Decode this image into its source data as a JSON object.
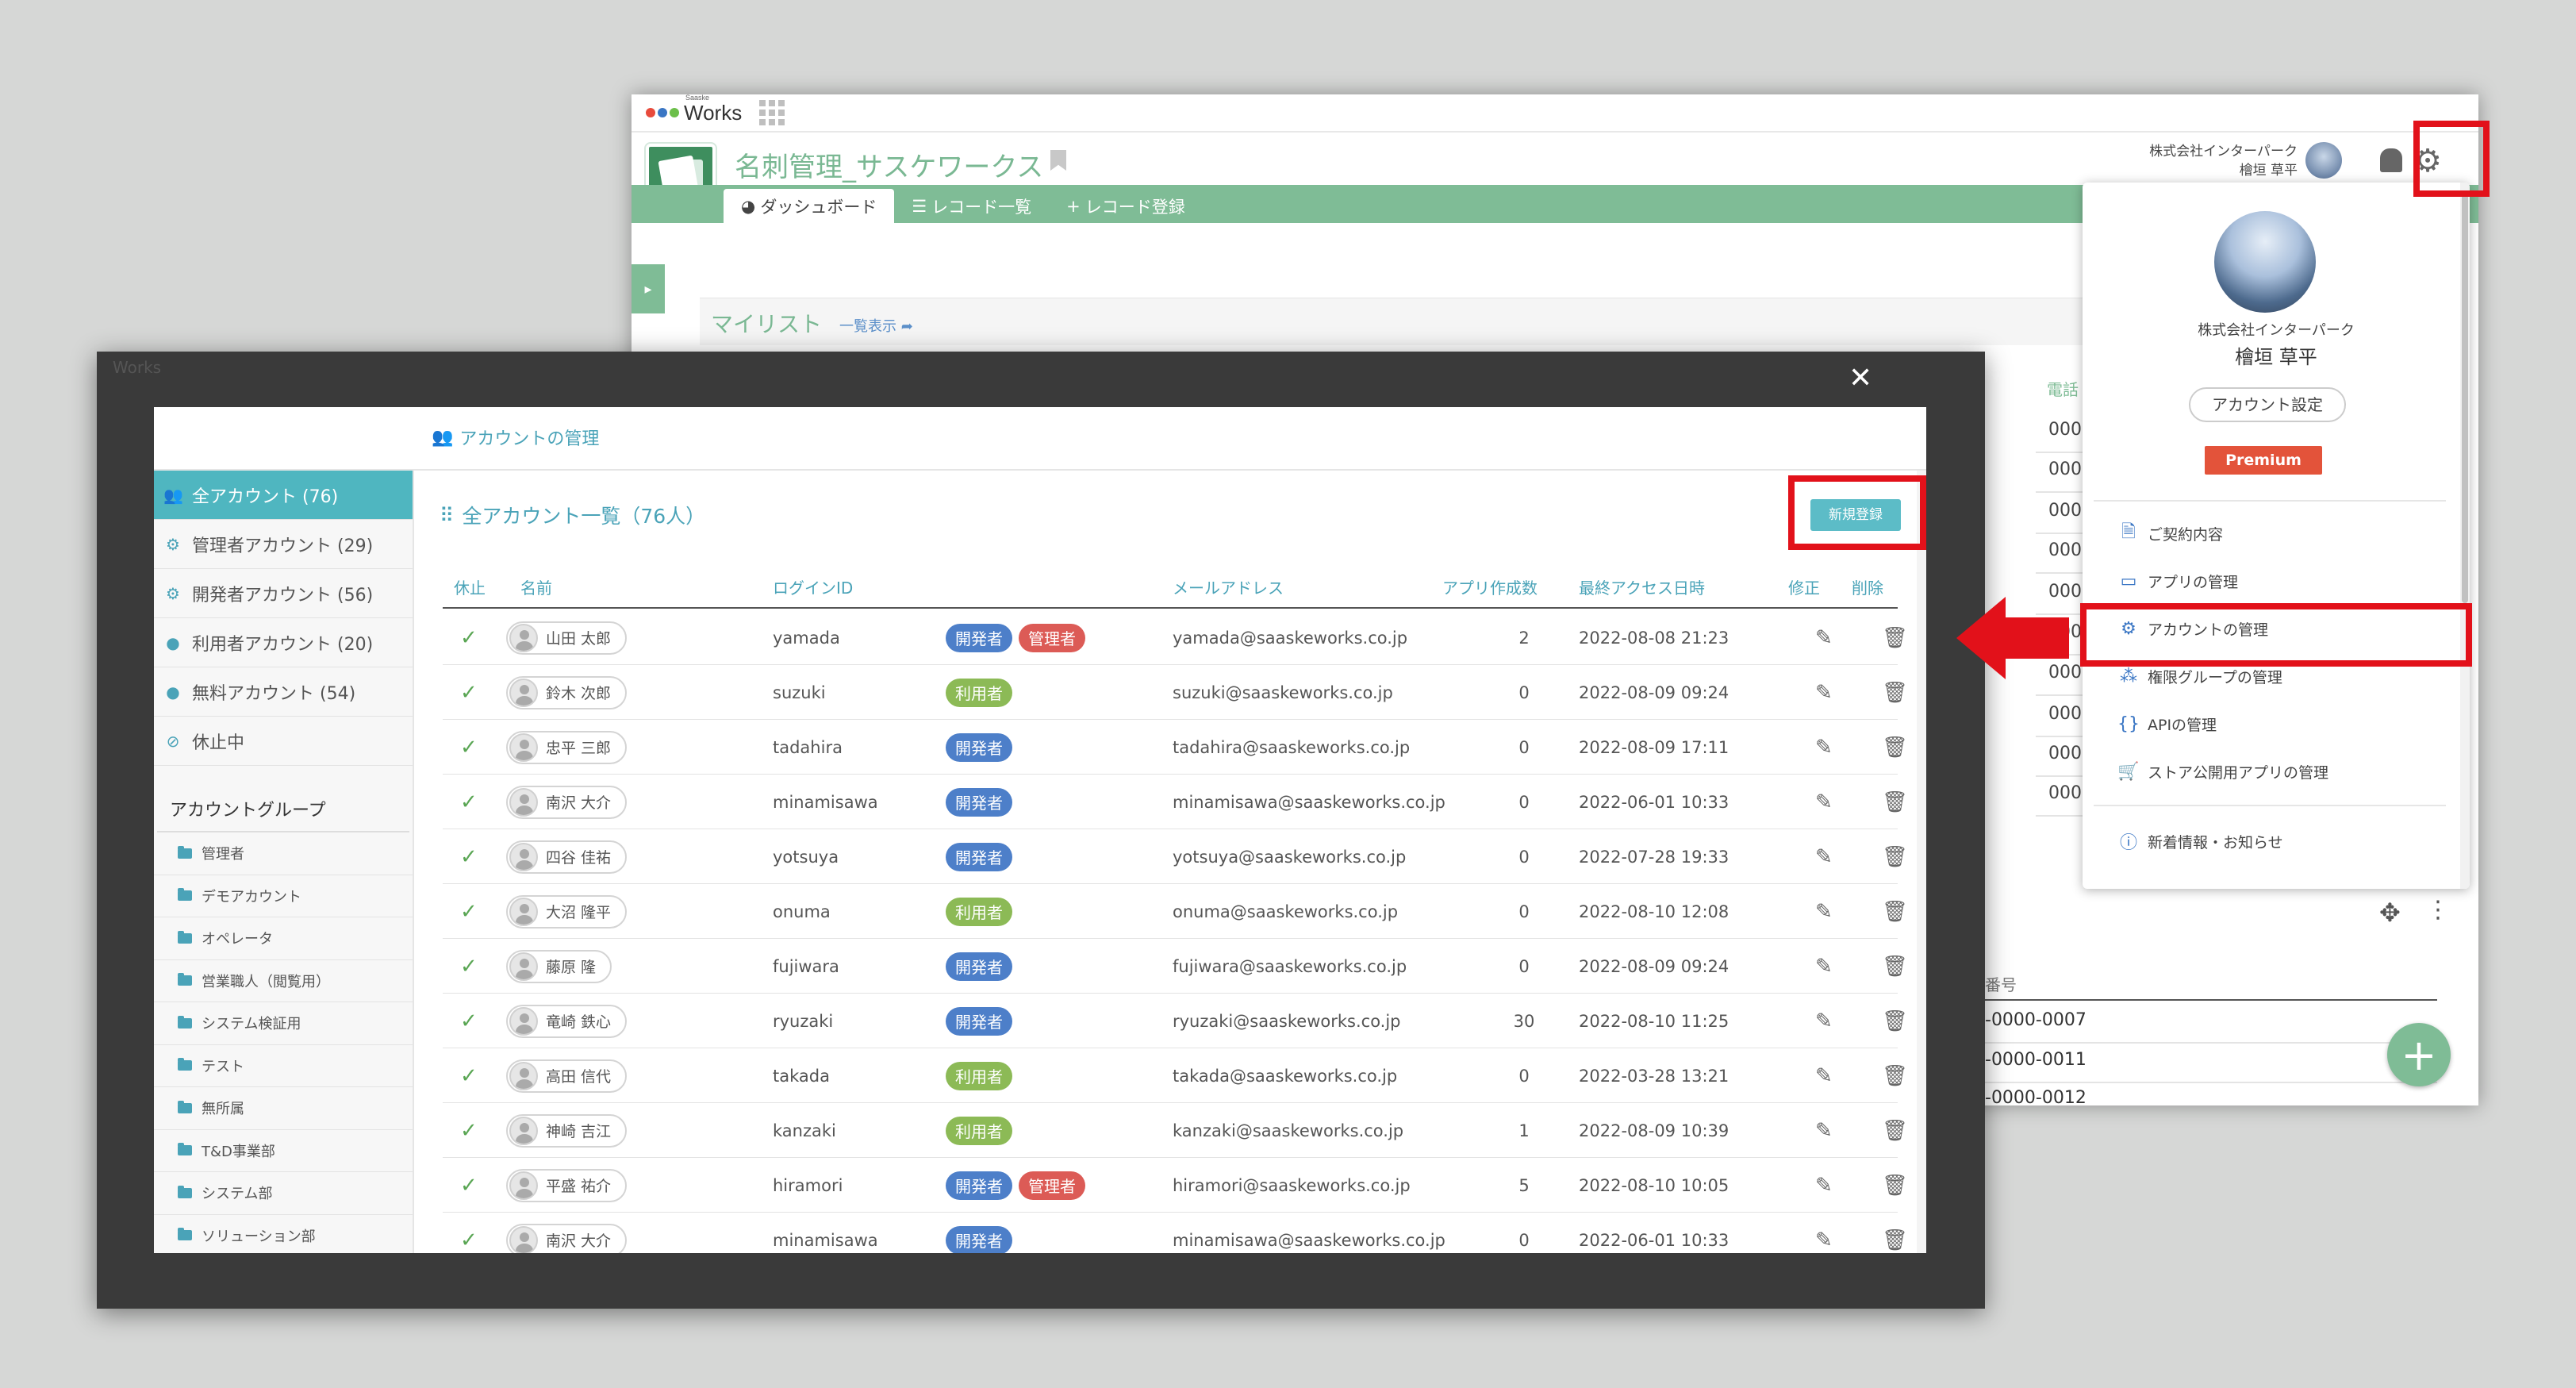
{
  "app": {
    "logo_sub": "Saaske",
    "logo_text": "Works",
    "title": "名刺管理_サスケワークス",
    "tabs": [
      {
        "label": "ダッシュボード",
        "icon": "dashboard-icon"
      },
      {
        "label": "レコード一覧",
        "icon": "list-icon"
      },
      {
        "label": "レコード登録",
        "icon": "plus-icon"
      }
    ],
    "company": "株式会社インターパーク",
    "user": "檜垣 草平",
    "mylist_title": "マイリスト",
    "mylist_link": "一覧表示",
    "phone_header": "電話",
    "phone_cells": [
      "000-",
      "000-",
      "000-",
      "000-",
      "000-",
      "000-",
      "000-",
      "000-",
      "000-",
      "000-"
    ],
    "right_header": "番号",
    "right_cells": [
      "-0000-0007",
      "-0000-0011",
      "-0000-0012"
    ]
  },
  "dropdown": {
    "company": "株式会社インターパーク",
    "user": "檜垣 草平",
    "account_setting": "アカウント設定",
    "plan": "Premium",
    "items": [
      {
        "label": "ご契約内容",
        "icon": "contract-icon"
      },
      {
        "label": "アプリの管理",
        "icon": "app-window-icon"
      },
      {
        "label": "アカウントの管理",
        "icon": "users-gear-icon"
      },
      {
        "label": "権限グループの管理",
        "icon": "group-icon"
      },
      {
        "label": "APIの管理",
        "icon": "braces-icon"
      },
      {
        "label": "ストア公開用アプリの管理",
        "icon": "cart-icon"
      },
      {
        "label": "新着情報・お知らせ",
        "icon": "info-icon"
      }
    ]
  },
  "modal": {
    "title": "アカウントの管理",
    "sidebar": [
      {
        "label": "全アカウント (76)",
        "icon": "users-icon",
        "active": true
      },
      {
        "label": "管理者アカウント (29)",
        "icon": "admin-icon"
      },
      {
        "label": "開発者アカウント (56)",
        "icon": "developer-icon"
      },
      {
        "label": "利用者アカウント (20)",
        "icon": "user-icon"
      },
      {
        "label": "無料アカウント (54)",
        "icon": "user-icon"
      },
      {
        "label": "休止中",
        "icon": "user-slash-icon"
      }
    ],
    "group_title": "アカウントグループ",
    "groups": [
      "管理者",
      "デモアカウント",
      "オペレータ",
      "営業職人（閲覧用）",
      "システム検証用",
      "テスト",
      "無所属",
      "T&D事業部",
      "システム部",
      "ソリューション部"
    ],
    "list_title": "全アカウント一覧（76人）",
    "new_button": "新規登録",
    "columns": [
      "休止",
      "名前",
      "ログインID",
      "メールアドレス",
      "アプリ作成数",
      "最終アクセス日時",
      "修正",
      "削除"
    ],
    "rows": [
      {
        "name": "山田 太郎",
        "login": "yamada",
        "roles": [
          "dev",
          "admin"
        ],
        "email": "yamada@saaskeworks.co.jp",
        "apps": "2",
        "last": "2022-08-08 21:23"
      },
      {
        "name": "鈴木 次郎",
        "login": "suzuki",
        "roles": [
          "user"
        ],
        "email": "suzuki@saaskeworks.co.jp",
        "apps": "0",
        "last": "2022-08-09 09:24"
      },
      {
        "name": "忠平 三郎",
        "login": "tadahira",
        "roles": [
          "dev"
        ],
        "email": "tadahira@saaskeworks.co.jp",
        "apps": "0",
        "last": "2022-08-09 17:11"
      },
      {
        "name": "南沢 大介",
        "login": "minamisawa",
        "roles": [
          "dev"
        ],
        "email": "minamisawa@saaskeworks.co.jp",
        "apps": "0",
        "last": "2022-06-01 10:33"
      },
      {
        "name": "四谷 佳祐",
        "login": "yotsuya",
        "roles": [
          "dev"
        ],
        "email": "yotsuya@saaskeworks.co.jp",
        "apps": "0",
        "last": "2022-07-28 19:33"
      },
      {
        "name": "大沼 隆平",
        "login": "onuma",
        "roles": [
          "user"
        ],
        "email": "onuma@saaskeworks.co.jp",
        "apps": "0",
        "last": "2022-08-10 12:08"
      },
      {
        "name": "藤原 隆",
        "login": "fujiwara",
        "roles": [
          "dev"
        ],
        "email": "fujiwara@saaskeworks.co.jp",
        "apps": "0",
        "last": "2022-08-09 09:24"
      },
      {
        "name": "竜崎 鉄心",
        "login": "ryuzaki",
        "roles": [
          "dev"
        ],
        "email": "ryuzaki@saaskeworks.co.jp",
        "apps": "30",
        "last": "2022-08-10 11:25"
      },
      {
        "name": "高田 信代",
        "login": "takada",
        "roles": [
          "user"
        ],
        "email": "takada@saaskeworks.co.jp",
        "apps": "0",
        "last": "2022-03-28 13:21"
      },
      {
        "name": "神崎 吉江",
        "login": "kanzaki",
        "roles": [
          "user"
        ],
        "email": "kanzaki@saaskeworks.co.jp",
        "apps": "1",
        "last": "2022-08-09 10:39"
      },
      {
        "name": "平盛 祐介",
        "login": "hiramori",
        "roles": [
          "dev",
          "admin"
        ],
        "email": "hiramori@saaskeworks.co.jp",
        "apps": "5",
        "last": "2022-08-10 10:05"
      },
      {
        "name": "南沢 大介",
        "login": "minamisawa",
        "roles": [
          "dev"
        ],
        "email": "minamisawa@saaskeworks.co.jp",
        "apps": "0",
        "last": "2022-06-01 10:33"
      }
    ],
    "role_labels": {
      "dev": "開発者",
      "admin": "管理者",
      "user": "利用者"
    }
  },
  "colors": {
    "accent": "#4aa3b8",
    "app_green": "#7fbc96",
    "highlight": "#e2111a"
  }
}
